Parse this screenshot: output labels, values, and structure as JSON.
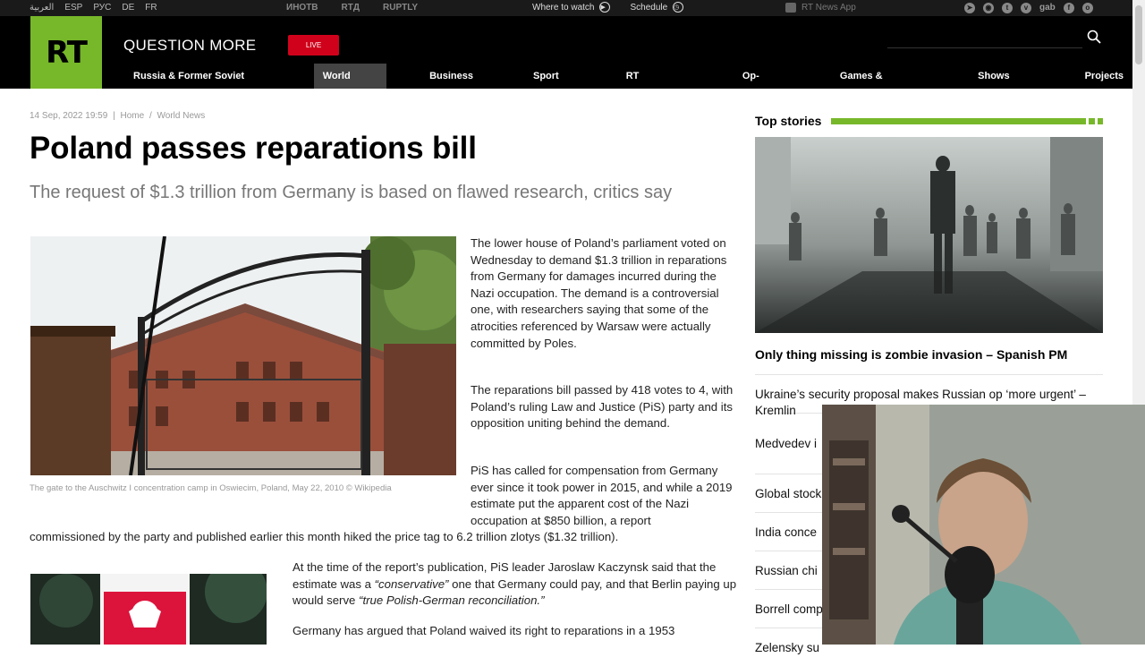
{
  "topbar": {
    "langs": [
      "العربية",
      "ESP",
      "РУС",
      "DE",
      "FR"
    ],
    "partners": [
      "ИНОТВ",
      "RTД",
      "RUPTLY"
    ],
    "where_to_watch": "Where to watch",
    "schedule": "Schedule",
    "app": "RT News App",
    "social_gab": "gab"
  },
  "header": {
    "logo": "RT",
    "slogan": "QUESTION MORE",
    "live": "LIVE",
    "nav": [
      "Russia & Former Soviet Union",
      "World News",
      "Business",
      "Sport",
      "RT Features",
      "Op-ed",
      "Games & Culture",
      "Shows",
      "Projects"
    ]
  },
  "article": {
    "date": "14 Sep, 2022 19:59",
    "crumb_home": "Home",
    "crumb_section": "World News",
    "title": "Poland passes reparations bill",
    "subtitle": "The request of $1.3 trillion from Germany is based on flawed research, critics say",
    "caption": "The gate to the Auschwitz I concentration camp in Oswiecim, Poland, May 22, 2010 ©  Wikipedia",
    "p1": "The lower house of Poland’s parliament voted on Wednesday to demand $1.3 trillion in reparations from Germany for damages incurred during the Nazi occupation. The demand is a controversial one, with researchers saying that some of the atrocities referenced by Warsaw were actually committed by Poles.",
    "p2": "The reparations bill passed by 418 votes to 4, with Poland’s ruling Law and Justice (PiS) party and its opposition uniting behind the demand.",
    "p3": "PiS has called for compensation from Germany ever since it took power in 2015, and while a 2019 estimate put the apparent cost of the Nazi occupation at $850 billion, a report",
    "p3b": "commissioned by the party and published earlier this month hiked the price tag to 6.2 trillion zlotys ($1.32 trillion).",
    "p4_a": "At the time of the report’s publication, PiS leader Jaroslaw Kaczynsk said that the estimate was a ",
    "p4_i1": "“conservative”",
    "p4_b": " one that Germany could pay, and that Berlin paying up would serve ",
    "p4_i2": "“true Polish-German reconciliation.”",
    "p5": "Germany has argued that Poland waived its right to reparations in a 1953"
  },
  "sidebar": {
    "heading": "Top stories",
    "lead": "Only thing missing is zombie invasion – Spanish PM",
    "stories": [
      "Ukraine’s security proposal makes Russian op ‘more urgent’ – Kremlin",
      "Medvedev i",
      "Global stock",
      "India conce",
      "Russian chi",
      "Borrell comp",
      "Zelensky su"
    ]
  }
}
